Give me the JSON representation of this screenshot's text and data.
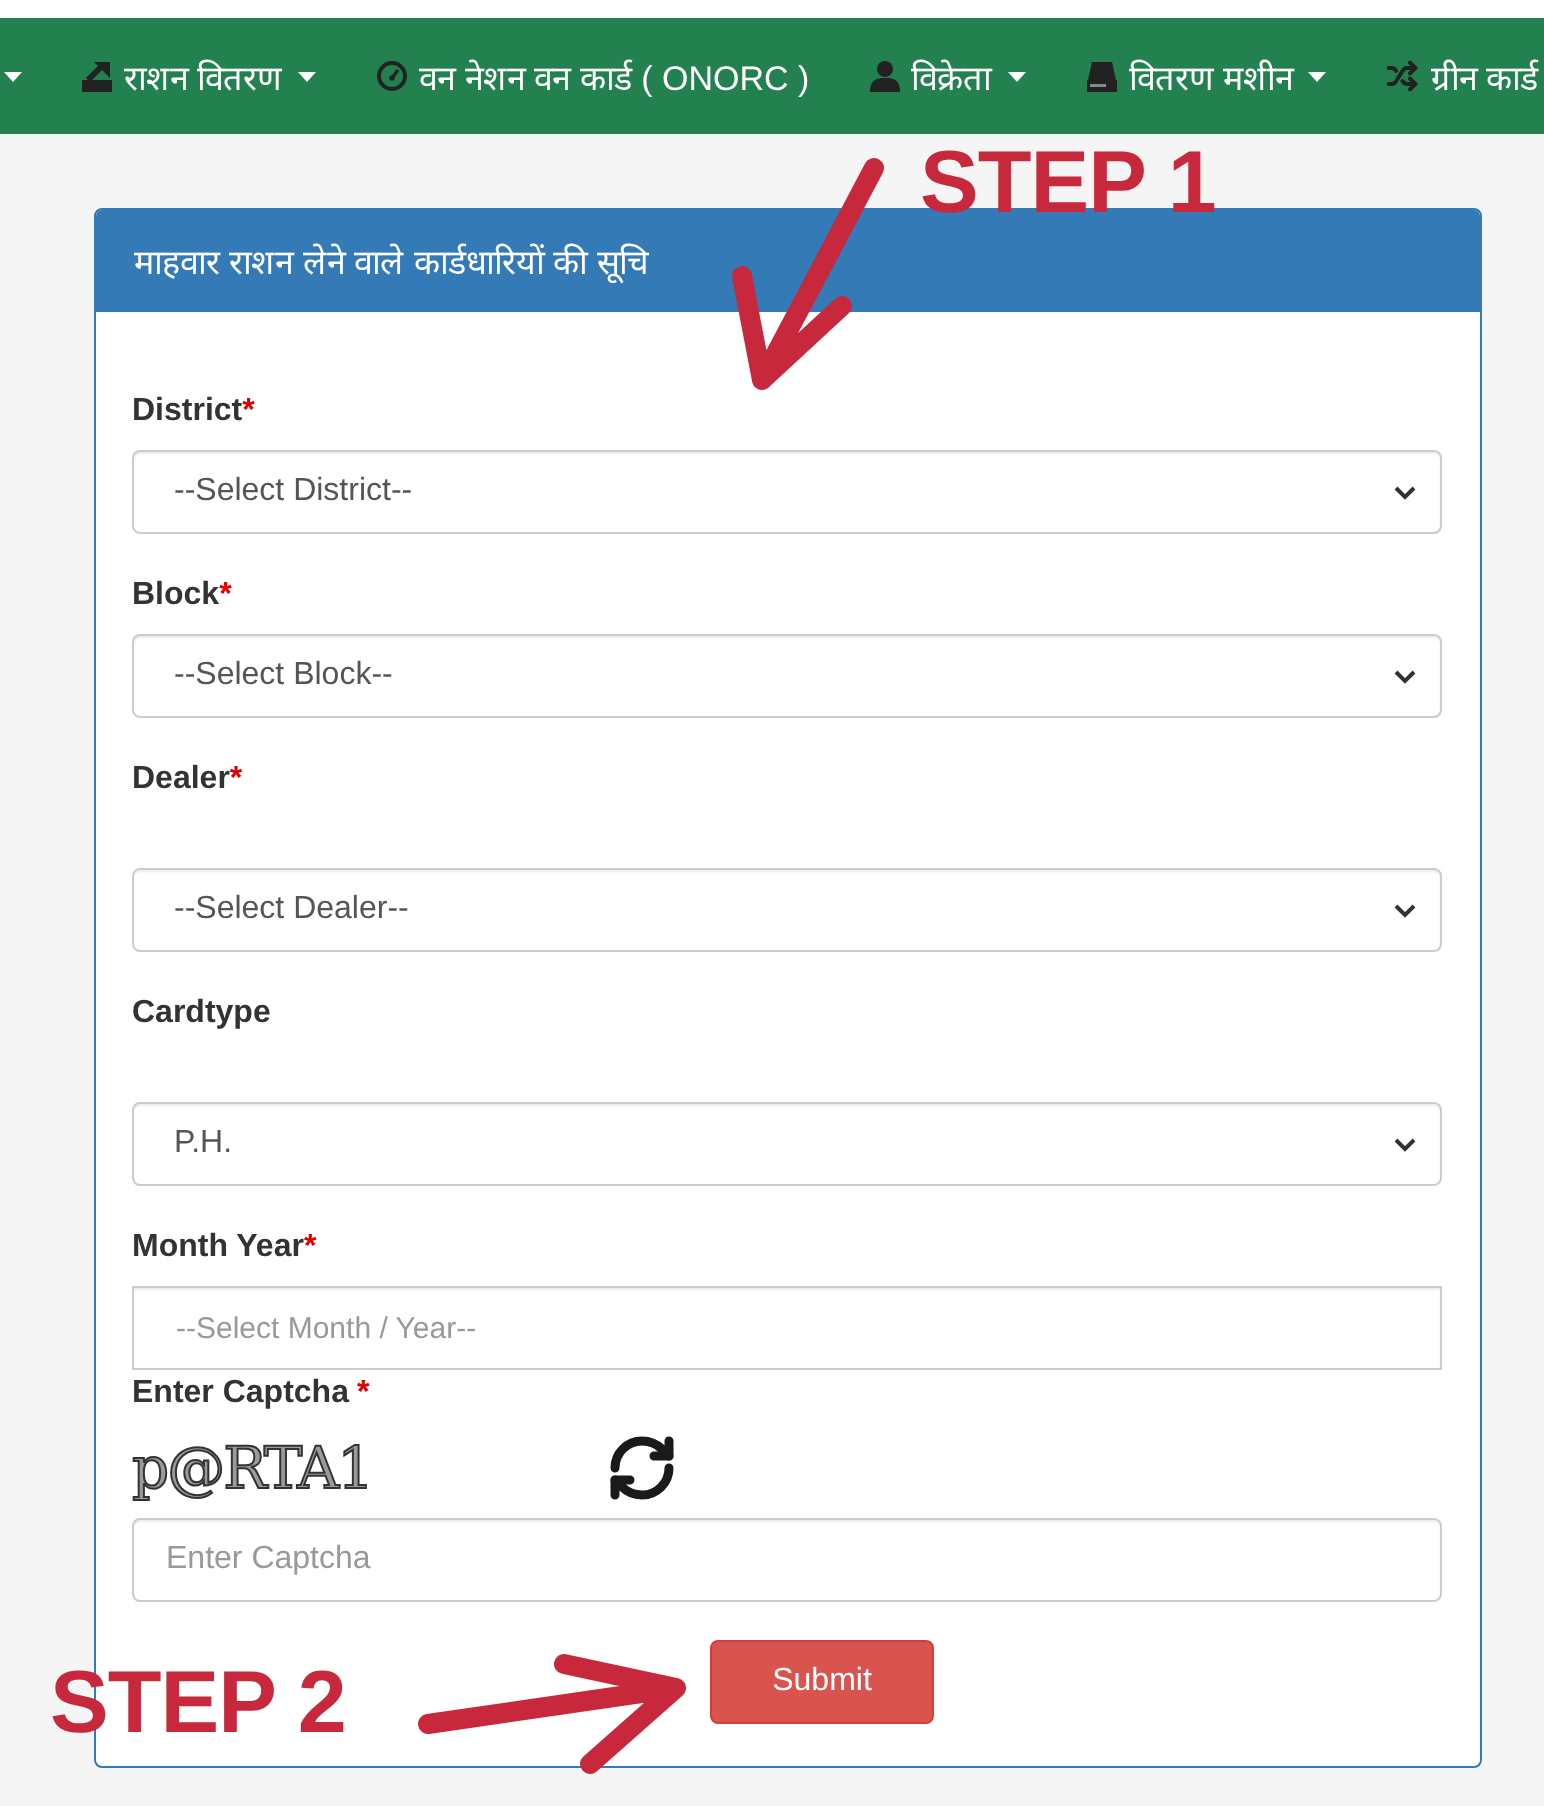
{
  "nav": {
    "items": [
      {
        "label": "राशन वितरण",
        "dropdown": true
      },
      {
        "label": "वन नेशन वन कार्ड ( ONORC )",
        "dropdown": false
      },
      {
        "label": "विक्रेता",
        "dropdown": true
      },
      {
        "label": "वितरण मशीन",
        "dropdown": true
      },
      {
        "label": "ग्रीन कार्ड",
        "dropdown": false
      }
    ]
  },
  "panel": {
    "title": "माहवार राशन लेने वाले कार्डधारियों की सूचि",
    "fields": [
      {
        "kind": "select",
        "label": "District",
        "required_mark": "*",
        "value": "--Select District--"
      },
      {
        "kind": "select",
        "label": "Block",
        "required_mark": "*",
        "value": "--Select Block--"
      },
      {
        "kind": "select",
        "label": "Dealer",
        "required_mark": "*",
        "value": "--Select Dealer--"
      },
      {
        "kind": "select",
        "label": "Cardtype",
        "value": "P.H."
      },
      {
        "kind": "input",
        "label": "Month Year",
        "required_mark": "*",
        "placeholder": "--Select Month / Year--"
      }
    ],
    "captcha": {
      "label": "Enter Captcha",
      "required_mark": "*",
      "image_text": "p@RTA1",
      "placeholder": "Enter Captcha"
    },
    "submit": "Submit"
  },
  "annotations": [
    {
      "text": "STEP 1"
    },
    {
      "text": "STEP 2"
    }
  ]
}
